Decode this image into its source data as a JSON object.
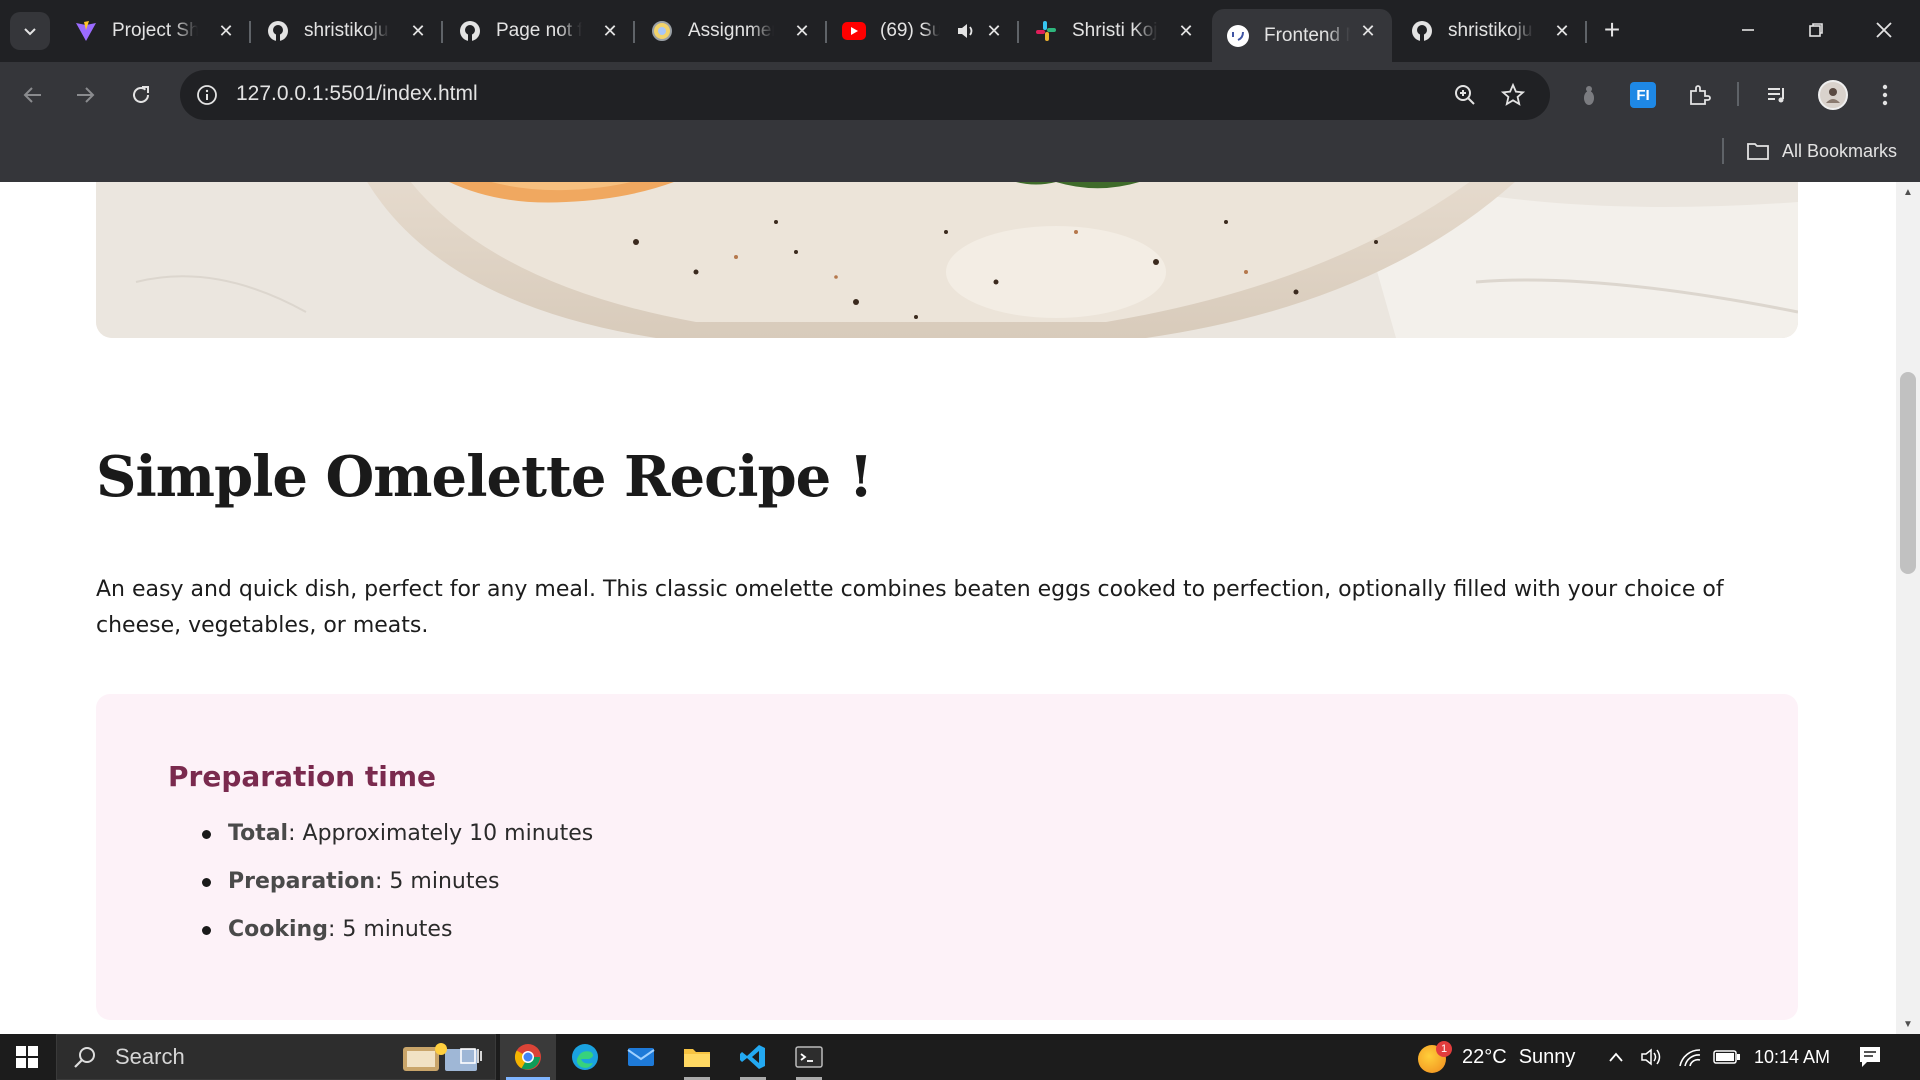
{
  "browser": {
    "tabs": [
      {
        "title": "Project Sh",
        "favicon": "vite-logo-icon",
        "active": false
      },
      {
        "title": "shristikoju",
        "favicon": "github-icon",
        "active": false
      },
      {
        "title": "Page not fo",
        "favicon": "github-icon",
        "active": false
      },
      {
        "title": "Assignmen",
        "favicon": "globe-icon",
        "active": false
      },
      {
        "title": "(69) Su",
        "favicon": "youtube-icon",
        "active": false,
        "audio": true
      },
      {
        "title": "Shristi Koju",
        "favicon": "slack-icon",
        "active": false
      },
      {
        "title": "Frontend M",
        "favicon": "frontend-mentor-icon",
        "active": true
      },
      {
        "title": "shristikoju",
        "favicon": "github-icon",
        "active": false
      }
    ],
    "address": {
      "url": "127.0.0.1:5501/index.html"
    },
    "bookmarks": {
      "all_label": "All Bookmarks"
    },
    "extension_label": "FI"
  },
  "page": {
    "title": "Simple Omelette Recipe !",
    "description": "An easy and quick dish, perfect for any meal. This classic omelette combines beaten eggs cooked to perfection, optionally filled with your choice of cheese, vegetables, or meats.",
    "prep": {
      "heading": "Preparation time",
      "items": [
        {
          "label": "Total",
          "value": ": Approximately 10 minutes"
        },
        {
          "label": "Preparation",
          "value": ": 5 minutes"
        },
        {
          "label": "Cooking",
          "value": ": 5 minutes"
        }
      ]
    },
    "colors": {
      "prep_bg": "#fdf2f8",
      "prep_heading": "#7a2a4e"
    }
  },
  "taskbar": {
    "search_label": "Search",
    "weather": {
      "temp": "22°C",
      "condition": "Sunny",
      "badge": "1"
    },
    "clock": "10:14 AM"
  }
}
